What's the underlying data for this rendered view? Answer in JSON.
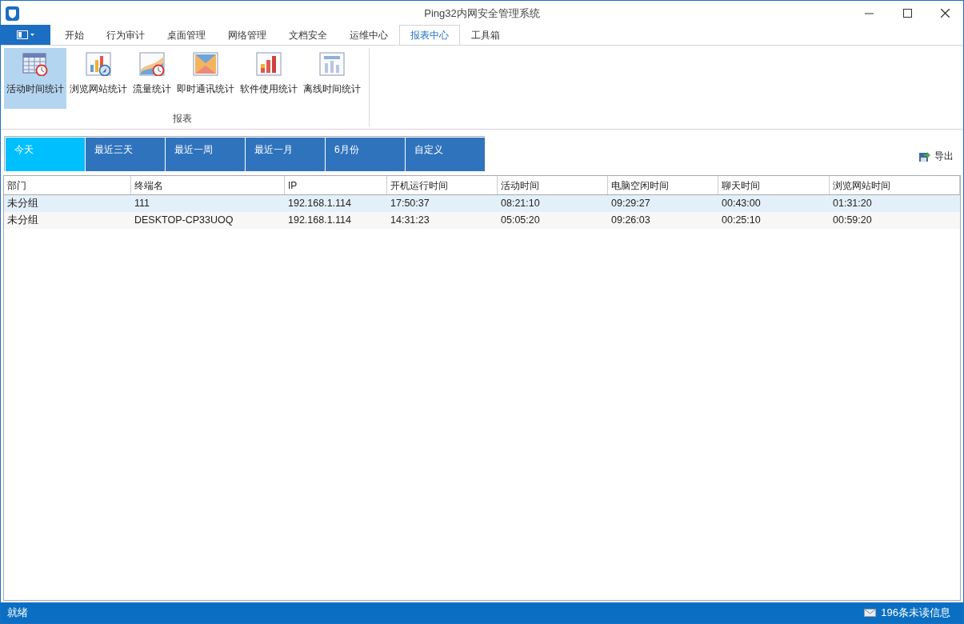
{
  "window": {
    "title": "Ping32内网安全管理系统"
  },
  "menu_tabs": [
    {
      "label": "开始",
      "selected": false
    },
    {
      "label": "行为审计",
      "selected": false
    },
    {
      "label": "桌面管理",
      "selected": false
    },
    {
      "label": "网络管理",
      "selected": false
    },
    {
      "label": "文档安全",
      "selected": false
    },
    {
      "label": "运维中心",
      "selected": false
    },
    {
      "label": "报表中心",
      "selected": true
    },
    {
      "label": "工具箱",
      "selected": false
    }
  ],
  "ribbon": {
    "group_label": "报表",
    "buttons": [
      {
        "label": "活动时间统计",
        "kind": "calendar",
        "selected": true
      },
      {
        "label": "浏览网站统计",
        "kind": "browse",
        "selected": false
      },
      {
        "label": "流量统计",
        "kind": "traffic",
        "selected": false
      },
      {
        "label": "即时通讯统计",
        "kind": "im",
        "selected": false
      },
      {
        "label": "软件使用统计",
        "kind": "software",
        "selected": false
      },
      {
        "label": "离线时间统计",
        "kind": "offline",
        "selected": false
      }
    ]
  },
  "period_tabs": [
    {
      "label": "今天",
      "selected": true
    },
    {
      "label": "最近三天",
      "selected": false
    },
    {
      "label": "最近一周",
      "selected": false
    },
    {
      "label": "最近一月",
      "selected": false
    },
    {
      "label": "6月份",
      "selected": false
    },
    {
      "label": "自定义",
      "selected": false
    }
  ],
  "export_button": "导出",
  "table": {
    "columns": [
      "部门",
      "终端名",
      "IP",
      "开机运行时间",
      "活动时间",
      "电脑空闲时间",
      "聊天时间",
      "浏览网站时间"
    ],
    "rows": [
      {
        "selected": true,
        "cells": [
          "未分组",
          "111",
          "192.168.1.114",
          "17:50:37",
          "08:21:10",
          "09:29:27",
          "00:43:00",
          "01:31:20"
        ]
      },
      {
        "selected": false,
        "cells": [
          "未分组",
          "DESKTOP-CP33UOQ",
          "192.168.1.114",
          "14:31:23",
          "05:05:20",
          "09:26:03",
          "00:25:10",
          "00:59:20"
        ]
      }
    ]
  },
  "status_bar": {
    "left": "就绪",
    "messages": "196条未读信息"
  }
}
